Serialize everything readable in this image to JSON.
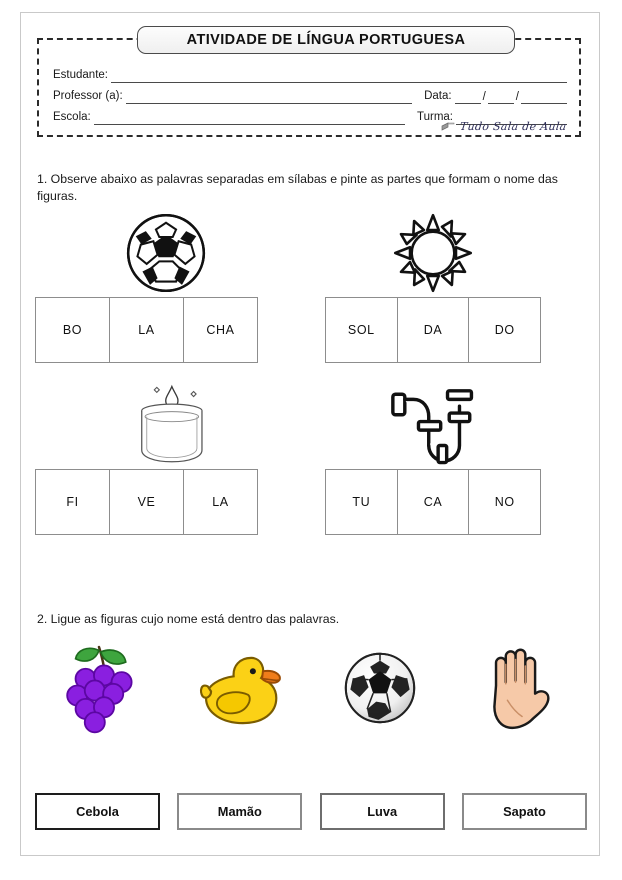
{
  "header": {
    "title": "ATIVIDADE DE LÍNGUA PORTUGUESA",
    "fields": {
      "student_label": "Estudante:",
      "teacher_label": "Professor (a):",
      "school_label": "Escola:",
      "date_label": "Data:",
      "class_label": "Turma:",
      "student_value": "",
      "teacher_value": "",
      "school_value": "",
      "date_value": "",
      "class_value": "",
      "date_slash_1": "/",
      "date_slash_2": "/"
    },
    "brand": {
      "text": "Tudo Sala de Aula",
      "icon": "book-icon"
    }
  },
  "exercises": [
    {
      "number": "1",
      "prompt": "1. Observe abaixo as palavras separadas em sílabas e pinte as partes que formam o nome das figuras.",
      "items": [
        {
          "figure": "soccer-ball-outline",
          "figure_name": "bola",
          "syllables": [
            "BO",
            "LA",
            "CHA"
          ]
        },
        {
          "figure": "sun-outline",
          "figure_name": "sol",
          "syllables": [
            "SOL",
            "DA",
            "DO"
          ]
        },
        {
          "figure": "candle-jar-outline",
          "figure_name": "vela",
          "syllables": [
            "FI",
            "VE",
            "LA"
          ]
        },
        {
          "figure": "pipe-trap-outline",
          "figure_name": "tubo",
          "syllables": [
            "TU",
            "CA",
            "NO"
          ]
        }
      ]
    },
    {
      "number": "2",
      "prompt": "2. Ligue as figuras cujo nome está dentro das palavras.",
      "figures": [
        {
          "figure": "grapes-icon",
          "figure_name": "uva"
        },
        {
          "figure": "rubber-duck-icon",
          "figure_name": "pato"
        },
        {
          "figure": "soccer-ball-icon",
          "figure_name": "bola"
        },
        {
          "figure": "open-hand-icon",
          "figure_name": "mao"
        }
      ],
      "words": [
        {
          "label": "Cebola",
          "border": "b-dark"
        },
        {
          "label": "Mamão",
          "border": "b-mid"
        },
        {
          "label": "Luva",
          "border": "b-light"
        },
        {
          "label": "Sapato",
          "border": "b-mid"
        }
      ]
    }
  ],
  "colors": {
    "page_border": "#c9c9c9",
    "header_dash": "#2b2b2b",
    "table_line": "#8d8d8d",
    "grape_purple": "#8a1fe0",
    "grape_leaf": "#3ea53e",
    "duck_yellow": "#fbd116",
    "duck_beak": "#ef7d1a",
    "hand_skin": "#f6c9a8",
    "text": "#1a1a1a"
  }
}
